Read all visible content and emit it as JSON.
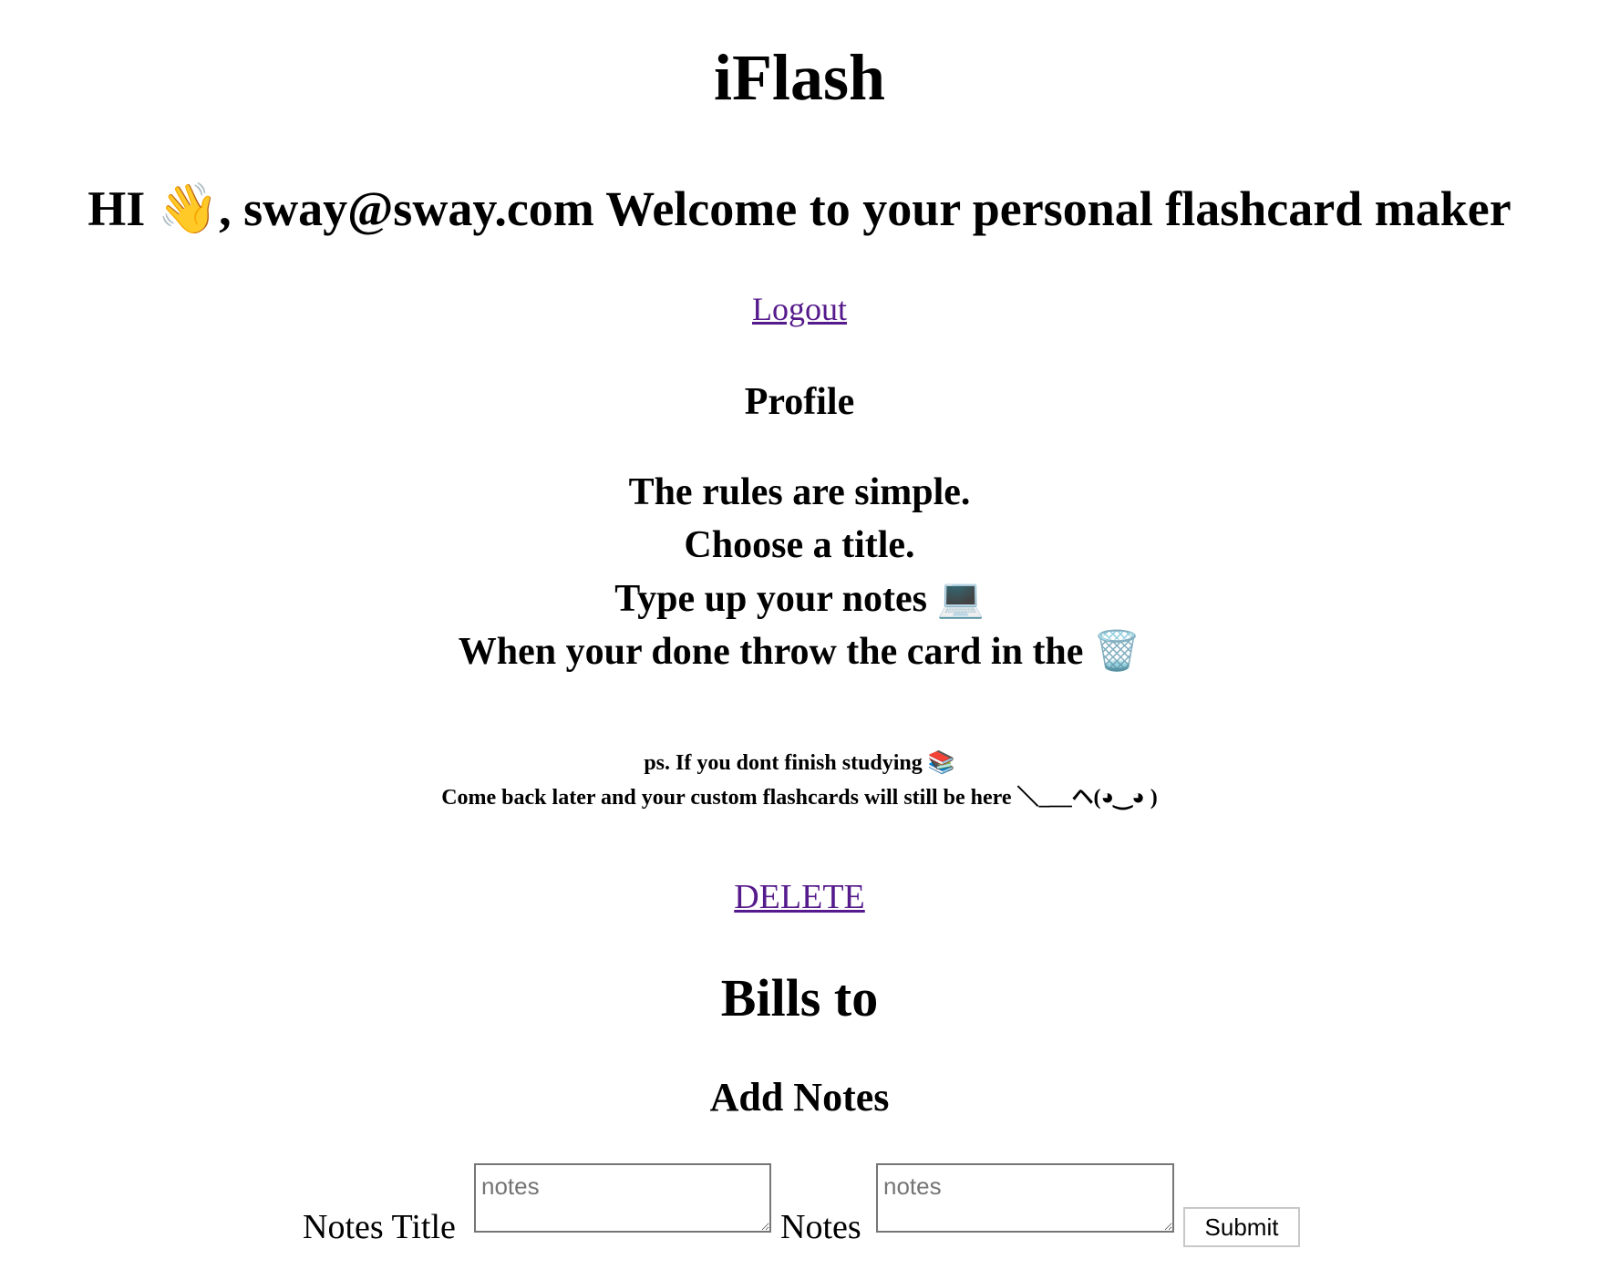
{
  "app": {
    "title": "iFlash"
  },
  "greeting": {
    "prefix": "HI",
    "wave_emoji": "👋",
    "email_part": ", sway@sway.com Welcome to your personal flashcard maker"
  },
  "nav": {
    "logout_label": "Logout"
  },
  "profile": {
    "heading": "Profile"
  },
  "rules": {
    "line1": "The rules are simple.",
    "line2": "Choose a title.",
    "line3": "Type up your notes",
    "line3_emoji": "💻",
    "line4": "When your done throw the card in the",
    "line4_emoji": "🗑️"
  },
  "ps": {
    "line1": "ps. If you dont finish studying",
    "line1_emoji": "📚",
    "line2": "Come back later and your custom flashcards will still be here ＼_＿ヘ(◕‿◕ )"
  },
  "card": {
    "delete_label": "DELETE",
    "title": "Bills to"
  },
  "add_notes": {
    "heading": "Add Notes",
    "title_label": "Notes Title",
    "title_placeholder": "notes",
    "title_value": "",
    "notes_label": "Notes",
    "notes_placeholder": "notes",
    "notes_value": "",
    "submit_label": "Submit"
  },
  "colors": {
    "link": "#551A8B",
    "text": "#000000",
    "background": "#ffffff"
  },
  "icons": {
    "wave": "waving-hand-icon",
    "laptop": "laptop-icon",
    "trash": "wastebasket-icon",
    "books": "books-icon"
  }
}
